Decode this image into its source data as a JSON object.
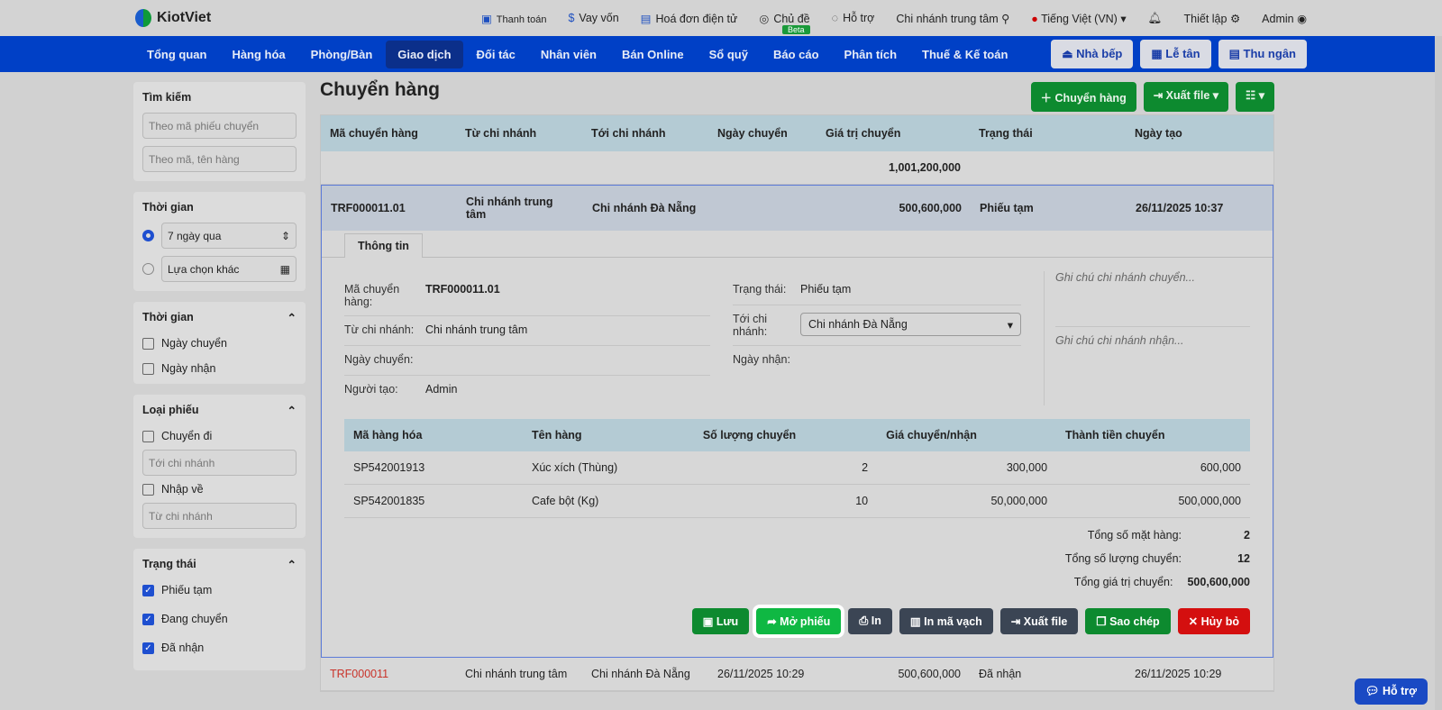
{
  "top": {
    "logo": "KiotViet",
    "links": [
      "Thanh toán",
      "Vay vốn",
      "Hoá đơn điện tử",
      "Chủ đề",
      "Hỗ trợ"
    ],
    "beta": "Beta",
    "branch": "Chi nhánh trung tâm",
    "language": "Tiếng Việt (VN)",
    "settings": "Thiết lập",
    "user": "Admin"
  },
  "nav": {
    "items": [
      "Tổng quan",
      "Hàng hóa",
      "Phòng/Bàn",
      "Giao dịch",
      "Đối tác",
      "Nhân viên",
      "Bán Online",
      "Sổ quỹ",
      "Báo cáo",
      "Phân tích",
      "Thuế & Kế toán"
    ],
    "right": [
      "Nhà bếp",
      "Lễ tân",
      "Thu ngân"
    ]
  },
  "side": {
    "search": {
      "title": "Tìm kiếm",
      "p1": "Theo mã phiếu chuyển",
      "p2": "Theo mã, tên hàng"
    },
    "time": {
      "title": "Thời gian",
      "opt1": "7 ngày qua",
      "opt2": "Lựa chọn khác"
    },
    "time2": {
      "title": "Thời gian",
      "a": "Ngày chuyển",
      "b": "Ngày nhận"
    },
    "type": {
      "title": "Loại phiếu",
      "a": "Chuyển đi",
      "ap": "Tới chi nhánh",
      "b": "Nhập về",
      "bp": "Từ chi nhánh"
    },
    "status": {
      "title": "Trạng thái",
      "a": "Phiếu tạm",
      "b": "Đang chuyển",
      "c": "Đã nhận"
    }
  },
  "main": {
    "title": "Chuyển hàng",
    "add": "Chuyển hàng",
    "export": "Xuất file",
    "cols": [
      "Mã chuyển hàng",
      "Từ chi nhánh",
      "Tới chi nhánh",
      "Ngày chuyển",
      "Giá trị chuyển",
      "Trạng thái",
      "Ngày tạo"
    ],
    "total": "1,001,200,000",
    "sel": {
      "code": "TRF000011.01",
      "from": "Chi nhánh trung tâm",
      "to": "Chi nhánh Đà Nẵng",
      "date": "",
      "value": "500,600,000",
      "status": "Phiếu tạm",
      "created": "26/11/2025 10:37"
    },
    "tab": "Thông tin",
    "info": {
      "k_code": "Mã chuyển hàng:",
      "code": "TRF000011.01",
      "k_from": "Từ chi nhánh:",
      "from": "Chi nhánh trung tâm",
      "k_date": "Ngày chuyển:",
      "k_creator": "Người tạo:",
      "creator": "Admin",
      "k_status": "Trạng thái:",
      "status": "Phiếu tạm",
      "k_to": "Tới chi nhánh:",
      "to": "Chi nhánh Đà Nẵng",
      "k_recv": "Ngày nhận:",
      "note1": "Ghi chú chi nhánh chuyển...",
      "note2": "Ghi chú chi nhánh nhận..."
    },
    "icols": [
      "Mã hàng hóa",
      "Tên hàng",
      "Số lượng chuyển",
      "Giá chuyển/nhận",
      "Thành tiền chuyển"
    ],
    "items": [
      [
        "SP542001913",
        "Xúc xích (Thùng)",
        "2",
        "300,000",
        "600,000"
      ],
      [
        "SP542001835",
        "Cafe bột (Kg)",
        "10",
        "50,000,000",
        "500,000,000"
      ]
    ],
    "totals": [
      [
        "Tổng số mặt hàng:",
        "2"
      ],
      [
        "Tổng số lượng chuyển:",
        "12"
      ],
      [
        "Tổng giá trị chuyển:",
        "500,600,000"
      ]
    ],
    "actions": [
      "Lưu",
      "Mở phiếu",
      "In",
      "In mã vạch",
      "Xuất file",
      "Sao chép",
      "Hủy bỏ"
    ],
    "row2": {
      "code": "TRF000011",
      "from": "Chi nhánh trung tâm",
      "to": "Chi nhánh Đà Nẵng",
      "date": "26/11/2025 10:29",
      "value": "500,600,000",
      "status": "Đã nhận",
      "created": "26/11/2025 10:29"
    }
  },
  "help": "Hỗ trợ"
}
